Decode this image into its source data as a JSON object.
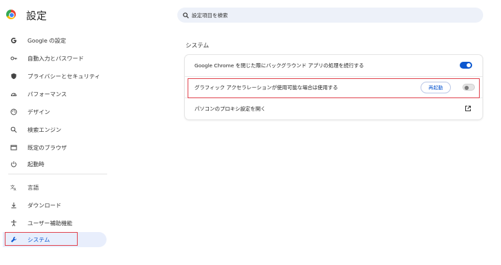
{
  "header": {
    "title": "設定",
    "search_placeholder": "設定項目を検索",
    "logo": "chrome-logo"
  },
  "sidebar": {
    "items": [
      {
        "label": "Google の設定",
        "icon": "google-g-icon"
      },
      {
        "label": "自動入力とパスワード",
        "icon": "key-icon"
      },
      {
        "label": "プライバシーとセキュリティ",
        "icon": "shield-icon"
      },
      {
        "label": "パフォーマンス",
        "icon": "speedometer-icon"
      },
      {
        "label": "デザイン",
        "icon": "palette-icon"
      },
      {
        "label": "検索エンジン",
        "icon": "search-icon"
      },
      {
        "label": "既定のブラウザ",
        "icon": "browser-icon"
      },
      {
        "label": "起動時",
        "icon": "power-icon"
      },
      {
        "label": "言語",
        "icon": "translate-icon"
      },
      {
        "label": "ダウンロード",
        "icon": "download-icon"
      },
      {
        "label": "ユーザー補助機能",
        "icon": "accessibility-icon"
      },
      {
        "label": "システム",
        "icon": "wrench-icon",
        "active": true
      }
    ]
  },
  "main": {
    "section_title": "システム",
    "rows": [
      {
        "label": "Google Chrome を閉じた際にバックグラウンド アプリの処理を続行する",
        "toggle": "on"
      },
      {
        "label": "グラフィック アクセラレーションが使用可能な場合は使用する",
        "button": "再起動",
        "toggle": "off"
      },
      {
        "label": "パソコンのプロキシ設定を開く",
        "icon": "open-external-icon"
      }
    ]
  },
  "colors": {
    "accent": "#0b57d0",
    "active_nav_bg": "#e8eefc",
    "highlight": "#e0414b"
  }
}
